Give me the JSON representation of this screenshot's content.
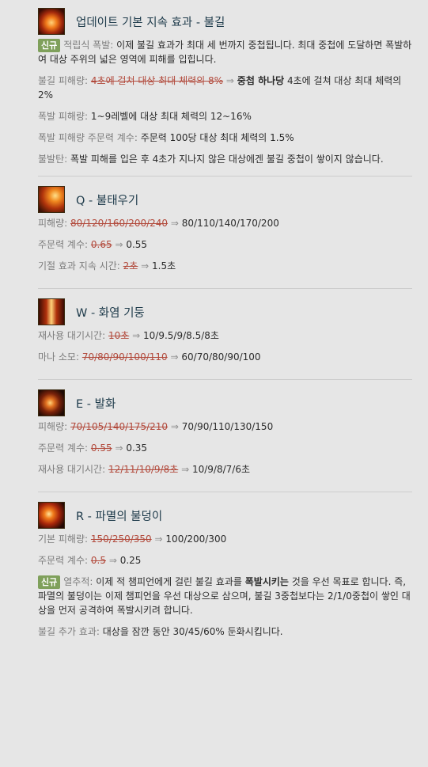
{
  "passive": {
    "title": "업데이트 기본 지속 효과 - 불길",
    "badge": "신규",
    "intro_label": "적립식 폭발:",
    "intro_text": " 이제 불길 효과가 최대 세 번까지 중첩됩니다. 최대 중첩에 도달하면 폭발하여 대상 주위의 넓은 영역에 피해를 입힙니다.",
    "burn_label": "불길 피해량:",
    "burn_old": "4초에 걸쳐 대상 최대 체력의 8%",
    "arrow": "⇒",
    "burn_new_bold": "중첩 하나당",
    "burn_new_rest": " 4초에 걸쳐 대상 최대 체력의 2%",
    "explode_label": "폭발 피해량:",
    "explode_text": " 1~9레벨에 대상 최대 체력의 12~16%",
    "ap_label": "폭발 피해량 주문력 계수:",
    "ap_text": " 주문력 100당 대상 최대 체력의 1.5%",
    "imm_label": "불발탄:",
    "imm_text": " 폭발 피해를 입은 후 4초가 지나지 않은 대상에겐 불길 중첩이 쌓이지 않습니다."
  },
  "q": {
    "title": "Q - 불태우기",
    "dmg_label": "피해량:",
    "dmg_old": "80/120/160/200/240",
    "dmg_new": "80/110/140/170/200",
    "ratio_label": "주문력 계수:",
    "ratio_old": "0.65",
    "ratio_new": "0.55",
    "stun_label": "기절 효과 지속 시간:",
    "stun_old": "2초",
    "stun_new": "1.5초"
  },
  "w": {
    "title": "W - 화염 기둥",
    "cd_label": "재사용 대기시간:",
    "cd_old": "10초",
    "cd_new": "10/9.5/9/8.5/8초",
    "mana_label": "마나 소모:",
    "mana_old": "70/80/90/100/110",
    "mana_new": "60/70/80/90/100"
  },
  "e": {
    "title": "E - 발화",
    "dmg_label": "피해량:",
    "dmg_old": "70/105/140/175/210",
    "dmg_new": "70/90/110/130/150",
    "ratio_label": "주문력 계수:",
    "ratio_old": "0.55",
    "ratio_new": "0.35",
    "cd_label": "재사용 대기시간:",
    "cd_old": "12/11/10/9/8초",
    "cd_new": "10/9/8/7/6초"
  },
  "r": {
    "title": "R - 파멸의 불덩이",
    "dmg_label": "기본 피해량:",
    "dmg_old": "150/250/350",
    "dmg_new": "100/200/300",
    "ratio_label": "주문력 계수:",
    "ratio_old": "0.5",
    "ratio_new": "0.25",
    "badge": "신규",
    "hot_label": "열추적:",
    "hot_pre": " 이제 적 챔피언에게 걸린 불길 효과를 ",
    "hot_bold": "폭발시키는",
    "hot_post": " 것을 우선 목표로 합니다. 즉, 파멸의 불덩이는 이제 챔피언을 우선 대상으로 삼으며, 불길 3중첩보다는 2/1/0중첩이 쌓인 대상을 먼저 공격하여 폭발시키려 합니다.",
    "slow_label": "불길 추가 효과:",
    "slow_text": " 대상을 잠깐 동안 30/45/60% 둔화시킵니다."
  },
  "icons": [
    "passive-fire-icon",
    "q-conflagration-icon",
    "w-pillar-of-flame-icon",
    "e-spark-icon",
    "r-pyroclasm-icon"
  ]
}
